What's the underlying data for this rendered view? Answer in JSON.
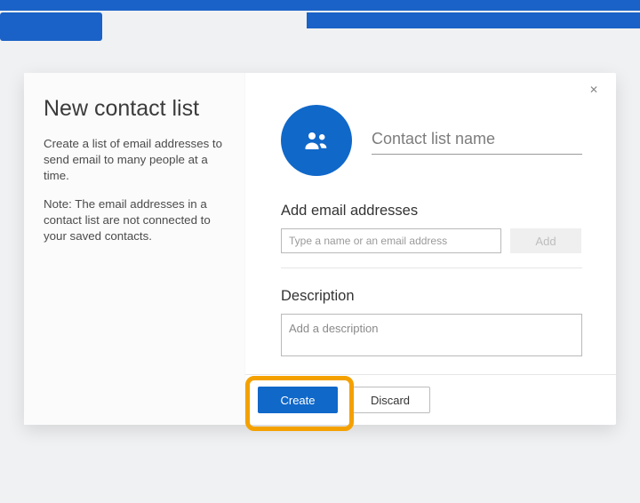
{
  "leftPane": {
    "title": "New contact list",
    "description": "Create a list of email addresses to send email to many people at a time.",
    "note": "Note: The email addresses in a contact list are not connected to your saved contacts."
  },
  "form": {
    "name_placeholder": "Contact list name",
    "name_value": "",
    "emailSection": {
      "label": "Add email addresses",
      "input_placeholder": "Type a name or an email address",
      "input_value": "",
      "add_button": "Add"
    },
    "descriptionSection": {
      "label": "Description",
      "textarea_placeholder": "Add a description",
      "textarea_value": ""
    }
  },
  "footer": {
    "create": "Create",
    "discard": "Discard"
  },
  "colors": {
    "primary": "#1068c9",
    "highlight": "#f4a100"
  }
}
